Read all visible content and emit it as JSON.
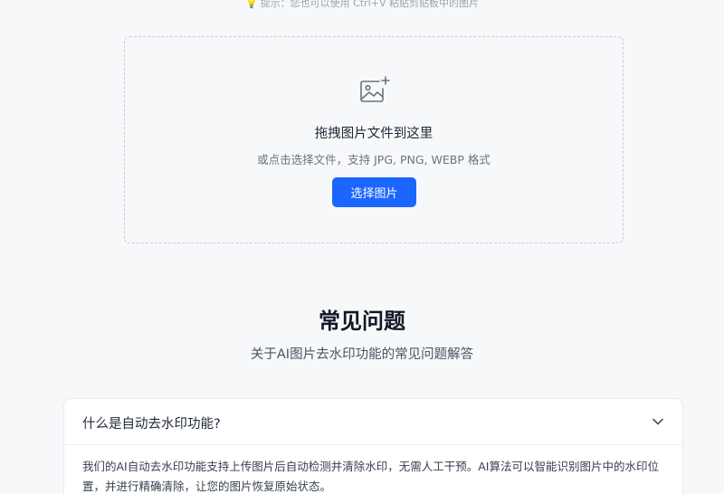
{
  "hint": {
    "icon": "lightbulb-icon",
    "text": "提示：您也可以使用 Ctrl+V 粘贴剪贴板中的图片"
  },
  "dropzone": {
    "icon": "image-add-icon",
    "title": "拖拽图片文件到这里",
    "subtitle": "或点击选择文件，支持 JPG, PNG, WEBP 格式",
    "button_label": "选择图片"
  },
  "faq": {
    "title": "常见问题",
    "subtitle": "关于AI图片去水印功能的常见问题解答",
    "items": [
      {
        "question": "什么是自动去水印功能?",
        "expanded": true,
        "answer": "我们的AI自动去水印功能支持上传图片后自动检测并清除水印，无需人工干预。AI算法可以智能识别图片中的水印位置，并进行精确清除，让您的图片恢复原始状态。"
      }
    ]
  },
  "colors": {
    "accent": "#1a66ff",
    "background": "#f7f8fa",
    "card": "#ffffff",
    "border_dashed": "#c9ced6"
  }
}
